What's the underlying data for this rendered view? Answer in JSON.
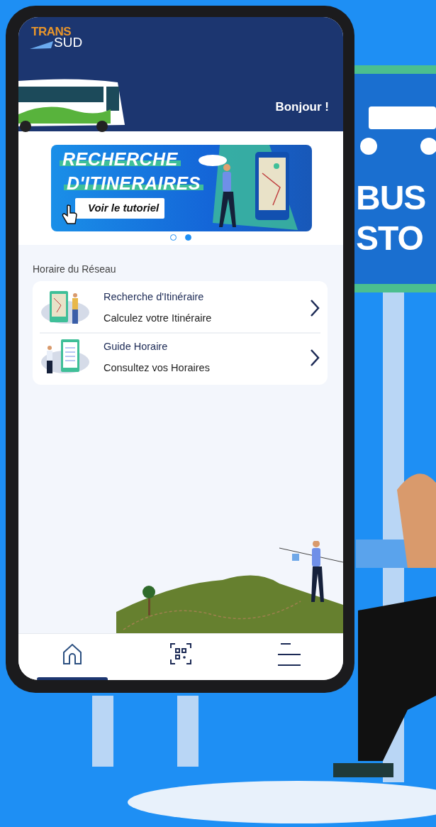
{
  "header": {
    "logo_top": "TRANS",
    "logo_bottom": "SUD",
    "greeting": "Bonjour !"
  },
  "banner": {
    "title_line_1": "RECHERCHE",
    "title_line_2": "D'ITINERAIRES",
    "button": "Voir le tutoriel"
  },
  "carousel_dots": [
    {
      "selected": false
    },
    {
      "selected": true
    }
  ],
  "section_title": "Horaire du Réseau",
  "menu_items": [
    {
      "kind": "route",
      "title": "Recherche d'Itinéraire",
      "subtitle": "Calculez votre Itinéraire"
    },
    {
      "kind": "timetable",
      "title": "Guide Horaire",
      "subtitle": "Consultez vos Horaires"
    }
  ],
  "bottom_nav": [
    {
      "kind": "home",
      "selected": true
    },
    {
      "kind": "scan",
      "selected": false
    },
    {
      "kind": "menu",
      "selected": false
    }
  ],
  "bus_stop_sign": {
    "line_1": "BUS",
    "line_2": "STO"
  }
}
